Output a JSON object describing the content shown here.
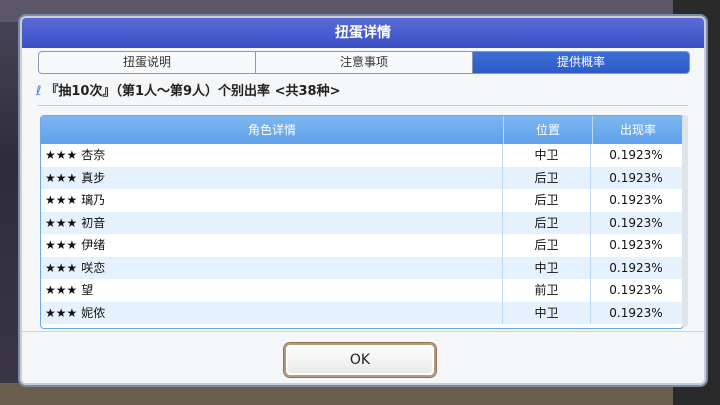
{
  "dialog": {
    "title": "扭蛋详情",
    "tabs": [
      "扭蛋说明",
      "注意事项",
      "提供概率"
    ],
    "active_tab": 2,
    "subheader": "『抽10次』（第1人～第9人）个别出率 <共38种>",
    "ok_label": "OK"
  },
  "table": {
    "headers": [
      "角色详情",
      "位置",
      "出现率"
    ],
    "rows": [
      {
        "stars": "★★★",
        "name": "杏奈",
        "position": "中卫",
        "rate": "0.1923%"
      },
      {
        "stars": "★★★",
        "name": "真步",
        "position": "后卫",
        "rate": "0.1923%"
      },
      {
        "stars": "★★★",
        "name": "璃乃",
        "position": "后卫",
        "rate": "0.1923%"
      },
      {
        "stars": "★★★",
        "name": "初音",
        "position": "后卫",
        "rate": "0.1923%"
      },
      {
        "stars": "★★★",
        "name": "伊绪",
        "position": "后卫",
        "rate": "0.1923%"
      },
      {
        "stars": "★★★",
        "name": "咲恋",
        "position": "中卫",
        "rate": "0.1923%"
      },
      {
        "stars": "★★★",
        "name": "望",
        "position": "前卫",
        "rate": "0.1923%"
      },
      {
        "stars": "★★★",
        "name": "妮侬",
        "position": "中卫",
        "rate": "0.1923%"
      }
    ]
  },
  "colors": {
    "title_bar": "#3b4fc4",
    "active_tab": "#2d5ac7",
    "table_header": "#5ea0ea",
    "row_alt": "#e5f1fc"
  },
  "system_nav": {
    "icons": [
      "square-icon",
      "circle-icon",
      "back-triangle-icon",
      "chevron-right-icon"
    ]
  }
}
